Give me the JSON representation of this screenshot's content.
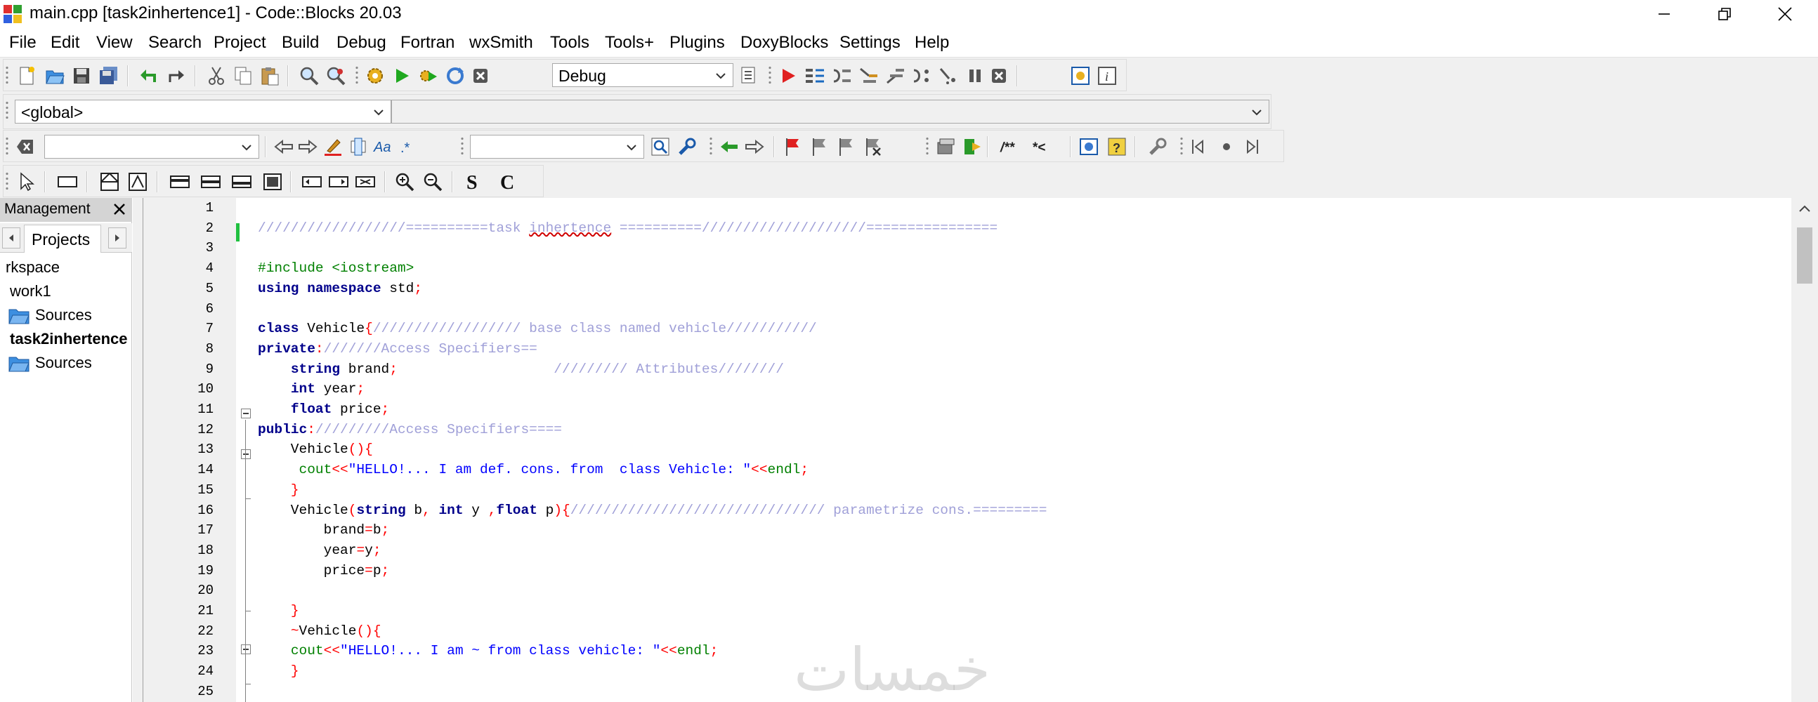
{
  "window": {
    "title": "main.cpp [task2inhertence1] - Code::Blocks 20.03",
    "controls": [
      "minimize",
      "restore",
      "close"
    ]
  },
  "menu": [
    "File",
    "Edit",
    "View",
    "Search",
    "Project",
    "Build",
    "Debug",
    "Fortran",
    "wxSmith",
    "Tools",
    "Tools+",
    "Plugins",
    "DoxyBlocks",
    "Settings",
    "Help"
  ],
  "toolbar": {
    "build_target": "Debug",
    "scope": "<global>",
    "function": "",
    "search_text": "",
    "find_text": ""
  },
  "management": {
    "title": "Management",
    "tab": "Projects",
    "tree": [
      "rkspace",
      "work1",
      "Sources",
      "task2inhertence",
      "Sources"
    ]
  },
  "editor": {
    "line_numbers": [
      "1",
      "2",
      "3",
      "4",
      "5",
      "6",
      "7",
      "8",
      "9",
      "10",
      "11",
      "12",
      "13",
      "14",
      "15",
      "16",
      "17",
      "18",
      "19",
      "20",
      "21",
      "22",
      "23",
      "24",
      "25"
    ],
    "lines": [
      [],
      [
        [
          "cm",
          "//////////////////==========task "
        ],
        [
          "cm sq",
          "inhertence"
        ],
        [
          "cm",
          " ==========////////////////////================"
        ]
      ],
      [],
      [
        [
          "pp",
          "#include <iostream>"
        ]
      ],
      [
        [
          "kw",
          "using"
        ],
        [
          "id",
          " "
        ],
        [
          "kw",
          "namespace"
        ],
        [
          "id",
          " std"
        ],
        [
          "op",
          ";"
        ]
      ],
      [],
      [
        [
          "kw",
          "class"
        ],
        [
          "id",
          " Vehicle"
        ],
        [
          "op",
          "{"
        ],
        [
          "cm",
          "////////////////// base class named vehicle///////////"
        ]
      ],
      [
        [
          "kw",
          "private"
        ],
        [
          "op",
          ":"
        ],
        [
          "cm",
          "///////Access Specifiers=="
        ]
      ],
      [
        [
          "id",
          "    "
        ],
        [
          "kw",
          "string"
        ],
        [
          "id",
          " brand"
        ],
        [
          "op",
          ";"
        ],
        [
          "id",
          "                   "
        ],
        [
          "cm",
          "///////// Attributes////////"
        ]
      ],
      [
        [
          "id",
          "    "
        ],
        [
          "kw",
          "int"
        ],
        [
          "id",
          " year"
        ],
        [
          "op",
          ";"
        ]
      ],
      [
        [
          "id",
          "    "
        ],
        [
          "kw",
          "float"
        ],
        [
          "id",
          " price"
        ],
        [
          "op",
          ";"
        ]
      ],
      [
        [
          "kw",
          "public"
        ],
        [
          "op",
          ":"
        ],
        [
          "cm",
          "/////////Access Specifiers===="
        ]
      ],
      [
        [
          "id",
          "    Vehicle"
        ],
        [
          "op",
          "(){"
        ]
      ],
      [
        [
          "id",
          "     "
        ],
        [
          "pp",
          "cout"
        ],
        [
          "op",
          "<<"
        ],
        [
          "st",
          "\"HELLO!... I am def. cons. from  class Vehicle: \""
        ],
        [
          "op",
          "<<"
        ],
        [
          "pp",
          "endl"
        ],
        [
          "op",
          ";"
        ]
      ],
      [
        [
          "id",
          "    "
        ],
        [
          "op",
          "}"
        ]
      ],
      [
        [
          "id",
          "    Vehicle"
        ],
        [
          "op",
          "("
        ],
        [
          "kw",
          "string"
        ],
        [
          "id",
          " b"
        ],
        [
          "op",
          ","
        ],
        [
          "id",
          " "
        ],
        [
          "kw",
          "int"
        ],
        [
          "id",
          " y "
        ],
        [
          "op",
          ","
        ],
        [
          "kw",
          "float"
        ],
        [
          "id",
          " p"
        ],
        [
          "op",
          "){"
        ],
        [
          "cm",
          "/////////////////////////////// parametrize cons.========="
        ]
      ],
      [
        [
          "id",
          "        brand"
        ],
        [
          "op",
          "="
        ],
        [
          "id",
          "b"
        ],
        [
          "op",
          ";"
        ]
      ],
      [
        [
          "id",
          "        year"
        ],
        [
          "op",
          "="
        ],
        [
          "id",
          "y"
        ],
        [
          "op",
          ";"
        ]
      ],
      [
        [
          "id",
          "        price"
        ],
        [
          "op",
          "="
        ],
        [
          "id",
          "p"
        ],
        [
          "op",
          ";"
        ]
      ],
      [],
      [
        [
          "id",
          "    "
        ],
        [
          "op",
          "}"
        ]
      ],
      [
        [
          "id",
          "    "
        ],
        [
          "op",
          "~"
        ],
        [
          "id",
          "Vehicle"
        ],
        [
          "op",
          "(){"
        ]
      ],
      [
        [
          "id",
          "    "
        ],
        [
          "pp",
          "cout"
        ],
        [
          "op",
          "<<"
        ],
        [
          "st",
          "\"HELLO!... I am ~ from class vehicle: \""
        ],
        [
          "op",
          "<<"
        ],
        [
          "pp",
          "endl"
        ],
        [
          "op",
          ";"
        ]
      ],
      [
        [
          "id",
          "    "
        ],
        [
          "op",
          "}"
        ]
      ],
      []
    ]
  },
  "watermark": "خمسات",
  "colors": {
    "keyword": "#00008b",
    "comment": "#a0a0d8",
    "preprocessor": "#008000",
    "operator": "#ff0000",
    "string": "#0000ff",
    "change_bar": "#20c040"
  }
}
